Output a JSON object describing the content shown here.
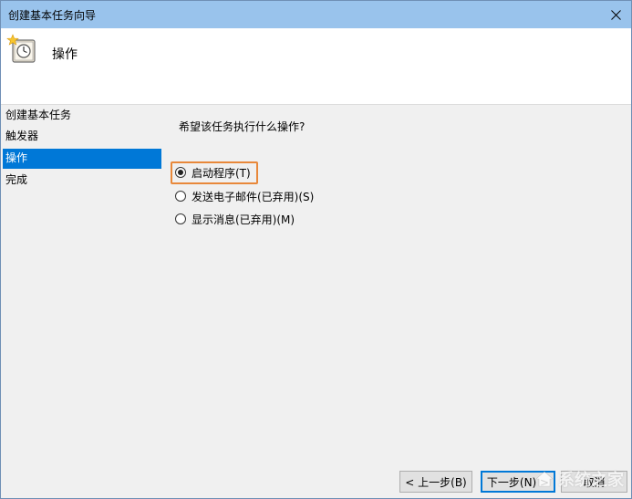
{
  "window": {
    "title": "创建基本任务向导",
    "close_icon": "close-icon"
  },
  "header": {
    "icon": "task-scheduler-clock-icon",
    "title": "操作"
  },
  "sidebar": {
    "items": [
      {
        "label": "创建基本任务",
        "active": false
      },
      {
        "label": "触发器",
        "active": false
      },
      {
        "label": "操作",
        "active": true
      },
      {
        "label": "完成",
        "active": false
      }
    ]
  },
  "content": {
    "question": "希望该任务执行什么操作?",
    "options": [
      {
        "label": "启动程序(T)",
        "checked": true
      },
      {
        "label": "发送电子邮件(已弃用)(S)",
        "checked": false
      },
      {
        "label": "显示消息(已弃用)(M)",
        "checked": false
      }
    ],
    "highlight_color": "#e8883a"
  },
  "footer": {
    "back_label": "< 上一步(B)",
    "next_label": "下一步(N) >",
    "cancel_label": "取消"
  },
  "watermark": {
    "text": "系统之家"
  },
  "colors": {
    "titlebar": "#99c3ec",
    "selection": "#0078d7"
  }
}
